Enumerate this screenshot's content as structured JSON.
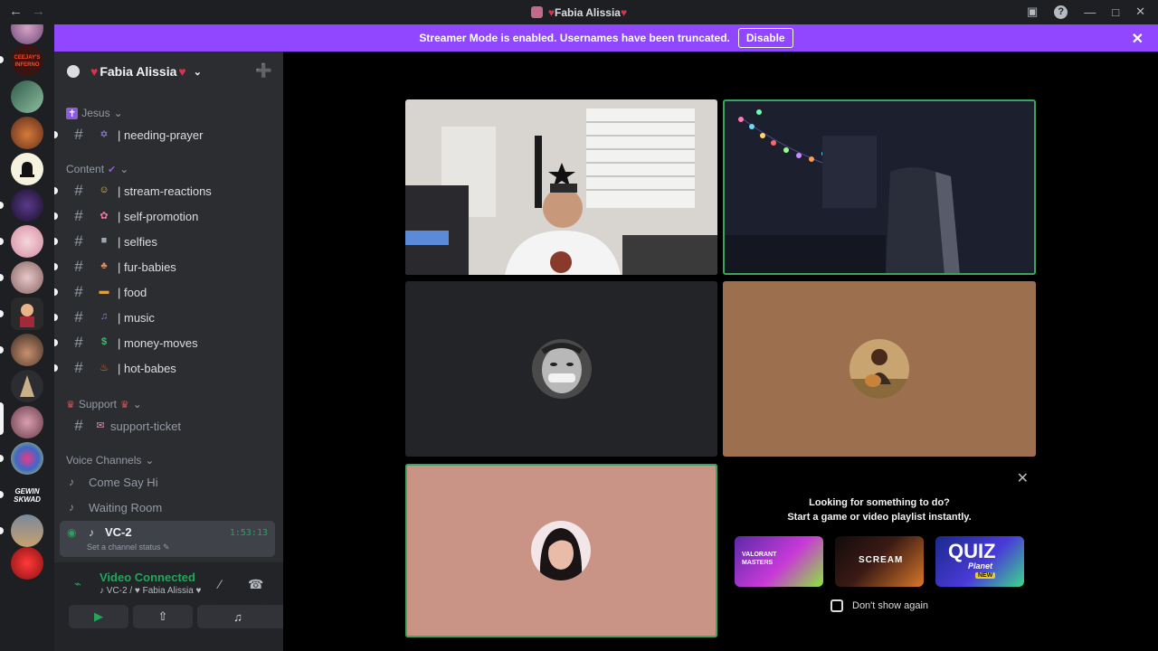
{
  "window": {
    "title_prefix": "♥",
    "title": "Fabia Alissia",
    "title_suffix": "♥",
    "nav_back": "←",
    "nav_forward": "→",
    "inbox_icon": "▣",
    "help_icon": "?",
    "minimize_icon": "—",
    "maximize_icon": "□",
    "close_icon": "✕"
  },
  "banner": {
    "message": "Streamer Mode is enabled. Usernames have been truncated.",
    "disable_label": "Disable",
    "close_icon": "✕",
    "color": "#9146ff"
  },
  "server": {
    "name_prefix": "♥",
    "name": "Fabia Alissia",
    "name_suffix": "♥",
    "chevron": "⌄",
    "invite_icon": "➕"
  },
  "categories": [
    {
      "emoji": "✝",
      "label": "Jesus",
      "chevron": "⌄"
    },
    {
      "emoji": "✔",
      "label": "Content",
      "chevron": "⌄"
    },
    {
      "emoji": "♛",
      "label": "Support",
      "suffix": "♛",
      "chevron": "⌄"
    },
    {
      "label": "Voice Channels",
      "chevron": "⌄"
    }
  ],
  "channels": [
    {
      "hash": "#",
      "emoji": "✡",
      "name": "| needing-prayer"
    },
    {
      "hash": "#",
      "emoji": "☺",
      "name": "| stream-reactions"
    },
    {
      "hash": "#",
      "emoji": "✿",
      "name": "| self-promotion"
    },
    {
      "hash": "#",
      "emoji": "■",
      "name": "| selfies"
    },
    {
      "hash": "#",
      "emoji": "♣",
      "name": "| fur-babies"
    },
    {
      "hash": "#",
      "emoji": "▬",
      "name": "| food"
    },
    {
      "hash": "#",
      "emoji": "♫",
      "name": "| music"
    },
    {
      "hash": "#",
      "emoji": "$",
      "name": "| money-moves"
    },
    {
      "hash": "#",
      "emoji": "♨",
      "name": "| hot-babes"
    },
    {
      "hash": "#",
      "emoji": "✉",
      "name": "support-ticket"
    }
  ],
  "voice_channels": [
    {
      "icon": "♪",
      "name": "Come Say Hi"
    },
    {
      "icon": "♪",
      "name": "Waiting Room"
    }
  ],
  "active_voice": {
    "live_icon": "◉",
    "speaker_icon": "♪",
    "name": "VC-2",
    "timer": "1:53:13",
    "status": "Set a channel status ✎"
  },
  "voice_panel": {
    "signal_icon": "⌁",
    "title": "Video Connected",
    "subtitle": "♪ VC-2 / ♥ Fabia Alissia ♥",
    "noise_icon": "∕",
    "hangup_icon": "☎",
    "buttons": [
      {
        "icon": "▶",
        "name": "camera"
      },
      {
        "icon": "⇧",
        "name": "screen-share"
      },
      {
        "icon": "✦",
        "name": "activities"
      },
      {
        "icon": "♫",
        "name": "soundboard"
      }
    ]
  },
  "activity": {
    "close_icon": "✕",
    "line1": "Looking for something to do?",
    "line2": "Start a game or video playlist instantly.",
    "cards": [
      {
        "label": "VALORANT MASTERS",
        "name": "valorant"
      },
      {
        "label": "SCREAM",
        "name": "scream"
      },
      {
        "label": "QUIZ",
        "sub": "Planet",
        "badge": "NEW",
        "name": "quiz-planet"
      }
    ],
    "checkbox_label": "Don't show again"
  },
  "video_tiles": [
    {
      "name": "camera-room-lights",
      "state": "video"
    },
    {
      "name": "camera-dark-room",
      "state": "video",
      "speaking": true
    },
    {
      "name": "avatar-bw",
      "state": "avatar",
      "background": "#232428"
    },
    {
      "name": "avatar-guitar",
      "state": "avatar",
      "background": "#9c6f4f"
    },
    {
      "name": "avatar-pink",
      "state": "avatar",
      "background": "#c99385",
      "speaking": true
    }
  ],
  "guild_sidebar": {
    "inferno_label": "CEEJAY'S INFERNO",
    "gewin_label": "GEWIN SKWAD"
  }
}
